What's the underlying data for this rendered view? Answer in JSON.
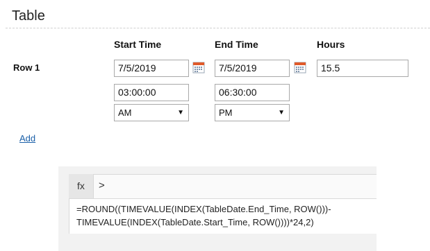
{
  "page": {
    "title": "Table"
  },
  "table": {
    "columns": [
      "Start Time",
      "End Time",
      "Hours"
    ],
    "rows": [
      {
        "label": "Row 1",
        "start_date": "7/5/2019",
        "end_date": "7/5/2019",
        "hours": "15.5",
        "start_time": "03:00:00",
        "end_time": "06:30:00",
        "start_ampm": "AM",
        "end_ampm": "PM"
      }
    ],
    "add_link": "Add"
  },
  "formula_bar": {
    "fx_label": "fx",
    "expand_glyph": ">",
    "formula_line1": "=ROUND((TIMEVALUE(INDEX(TableDate.End_Time, ROW()))-",
    "formula_line2": "TIMEVALUE(INDEX(TableDate.Start_Time, ROW())))*24,2)"
  },
  "icons": {
    "calendar": "calendar-icon",
    "select_caret": "caret-down-icon",
    "expand": "chevron-right-icon"
  },
  "colors": {
    "link": "#1a5fa8",
    "input_border": "#a9a9a9",
    "calendar_accent": "#e05a2a"
  }
}
